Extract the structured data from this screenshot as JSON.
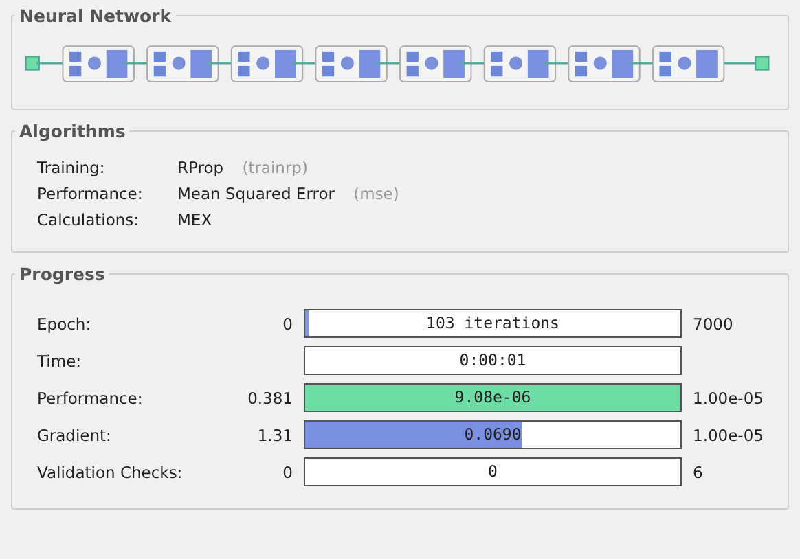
{
  "neural_network": {
    "title": "Neural Network"
  },
  "algorithms": {
    "title": "Algorithms",
    "rows": [
      {
        "label": "Training:",
        "value": "RProp",
        "note": "(trainrp)"
      },
      {
        "label": "Performance:",
        "value": "Mean Squared Error",
        "note": "(mse)"
      },
      {
        "label": "Calculations:",
        "value": "MEX"
      }
    ]
  },
  "progress": {
    "title": "Progress",
    "rows": [
      {
        "label": "Epoch:",
        "start": "0",
        "bar_text": "103 iterations",
        "level": 0.01,
        "color": "#7f95cf",
        "end": "7000"
      },
      {
        "label": "Time:",
        "bar_text": "0:00:01"
      },
      {
        "label": "Performance:",
        "start": "0.381",
        "bar_text": "9.08e-06",
        "level": 1,
        "color": "#6ddca5",
        "end": "1.00e-05"
      },
      {
        "label": "Gradient:",
        "start": "1.31",
        "bar_text": "0.0690",
        "level": 0.58,
        "color": "#7b8fe0",
        "end": "1.00e-05"
      },
      {
        "label": "Validation Checks:",
        "start": "0",
        "bar_text": "0",
        "end": "6"
      }
    ]
  }
}
